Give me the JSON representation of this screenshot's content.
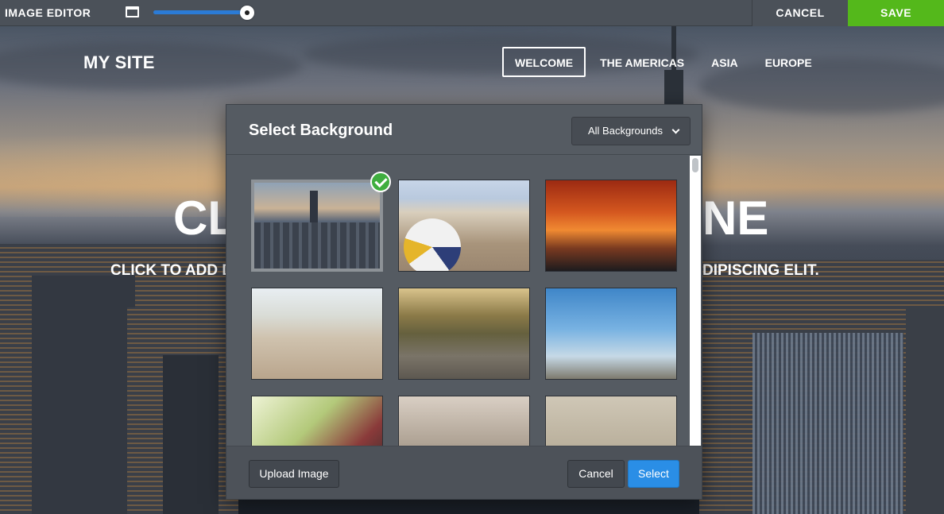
{
  "toolbar": {
    "title": "IMAGE EDITOR",
    "zoom_fraction": 0.93,
    "cancel_label": "CANCEL",
    "save_label": "SAVE",
    "save_color": "#54b81b"
  },
  "site": {
    "logo": "MY SITE",
    "nav": [
      {
        "label": "WELCOME",
        "active": true
      },
      {
        "label": "THE AMERICAS",
        "active": false
      },
      {
        "label": "ASIA",
        "active": false
      },
      {
        "label": "EUROPE",
        "active": false
      }
    ],
    "headline_left": "CL",
    "headline_right": "NE",
    "subline_left": "CLICK TO ADD DE",
    "subline_right": "DIPISCING ELIT."
  },
  "modal": {
    "title": "Select Background",
    "filter_label": "All Backgrounds",
    "filter_icon": "chevron-down-icon",
    "thumbnails": [
      {
        "name": "thumb-city-skyline",
        "selected": true
      },
      {
        "name": "thumb-volleyball-beach",
        "selected": false
      },
      {
        "name": "thumb-sunset-cyclists",
        "selected": false
      },
      {
        "name": "thumb-beach-swing",
        "selected": false
      },
      {
        "name": "thumb-road-cyclist",
        "selected": false
      },
      {
        "name": "thumb-cyclist-sky",
        "selected": false
      },
      {
        "name": "thumb-spin-class",
        "selected": false
      },
      {
        "name": "thumb-mountain-biker",
        "selected": false
      },
      {
        "name": "thumb-fishing-rod",
        "selected": false
      }
    ],
    "upload_label": "Upload Image",
    "cancel_label": "Cancel",
    "select_label": "Select",
    "select_color": "#2a8ee6"
  }
}
